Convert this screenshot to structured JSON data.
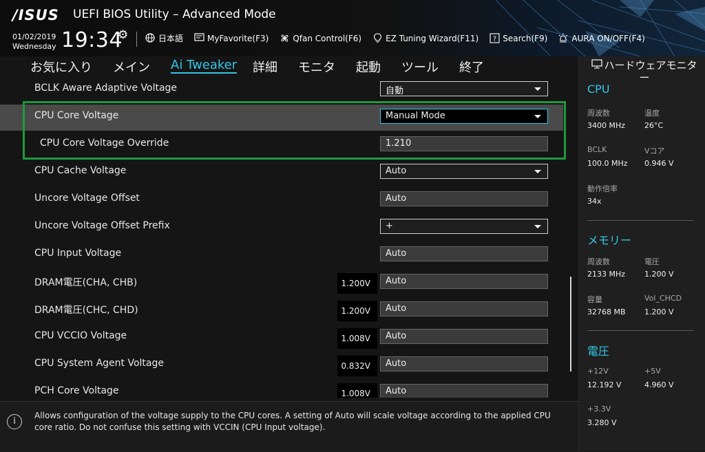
{
  "header": {
    "logo": "/ISUS",
    "title": "UEFI BIOS Utility – Advanced Mode",
    "date": "01/02/2019",
    "weekday": "Wednesday",
    "time": "19:34",
    "tools": [
      {
        "icon": "globe-icon",
        "label": "日本語"
      },
      {
        "icon": "favorite-icon",
        "label": "MyFavorite(F3)"
      },
      {
        "icon": "fan-icon",
        "label": "Qfan Control(F6)"
      },
      {
        "icon": "bulb-icon",
        "label": "EZ Tuning Wizard(F11)"
      },
      {
        "icon": "search-icon",
        "label": "Search(F9)"
      },
      {
        "icon": "aura-icon",
        "label": "AURA ON/OFF(F4)"
      }
    ]
  },
  "tabs": [
    "お気に入り",
    "メイン",
    "Ai Tweaker",
    "詳細",
    "モニタ",
    "起動",
    "ツール",
    "終了"
  ],
  "active_tab": "Ai Tweaker",
  "settings": [
    {
      "label": "BCLK Aware Adaptive Voltage",
      "value": "自動",
      "type": "dropdown"
    },
    {
      "label": "CPU Core Voltage",
      "value": "Manual Mode",
      "type": "dropdown",
      "selected": true
    },
    {
      "label": "CPU Core Voltage Override",
      "value": "1.210",
      "type": "input"
    },
    {
      "label": "CPU Cache Voltage",
      "value": "Auto",
      "type": "dropdown"
    },
    {
      "label": "Uncore Voltage Offset",
      "value": "Auto",
      "type": "input"
    },
    {
      "label": "Uncore Voltage Offset Prefix",
      "value": "+",
      "type": "dropdown"
    },
    {
      "label": "CPU Input Voltage",
      "value": "Auto",
      "type": "input"
    },
    {
      "label": "DRAM電圧(CHA, CHB)",
      "value": "Auto",
      "type": "input",
      "readout": "1.200V"
    },
    {
      "label": "DRAM電圧(CHC, CHD)",
      "value": "Auto",
      "type": "input",
      "readout": "1.200V"
    },
    {
      "label": "CPU VCCIO Voltage",
      "value": "Auto",
      "type": "input",
      "readout": "1.008V"
    },
    {
      "label": "CPU System Agent Voltage",
      "value": "Auto",
      "type": "input",
      "readout": "0.832V"
    },
    {
      "label": "PCH Core Voltage",
      "value": "Auto",
      "type": "input",
      "readout": "1.008V"
    }
  ],
  "help_text": "Allows configuration of the voltage supply to the CPU cores. A setting of Auto will scale voltage according to the applied CPU core ratio.  Do not confuse this setting with VCCIN (CPU Input voltage).",
  "monitor": {
    "title": "ハードウェアモニター",
    "cpu": {
      "title": "CPU",
      "freq_label": "周波数",
      "freq": "3400 MHz",
      "temp_label": "温度",
      "temp": "26°C",
      "bclk_label": "BCLK",
      "bclk": "100.0 MHz",
      "vcore_label": "Vコア",
      "vcore": "0.946 V",
      "ratio_label": "動作倍率",
      "ratio": "34x"
    },
    "memory": {
      "title": "メモリー",
      "freq_label": "周波数",
      "freq": "2133 MHz",
      "volt_label": "電圧",
      "volt": "1.200 V",
      "cap_label": "容量",
      "cap": "32768 MB",
      "vchcd_label": "Vol_CHCD",
      "vchcd": "1.200 V"
    },
    "voltage": {
      "title": "電圧",
      "v12_label": "+12V",
      "v12": "12.192 V",
      "v5_label": "+5V",
      "v5": "4.960 V",
      "v33_label": "+3.3V",
      "v33": "3.280 V"
    }
  }
}
